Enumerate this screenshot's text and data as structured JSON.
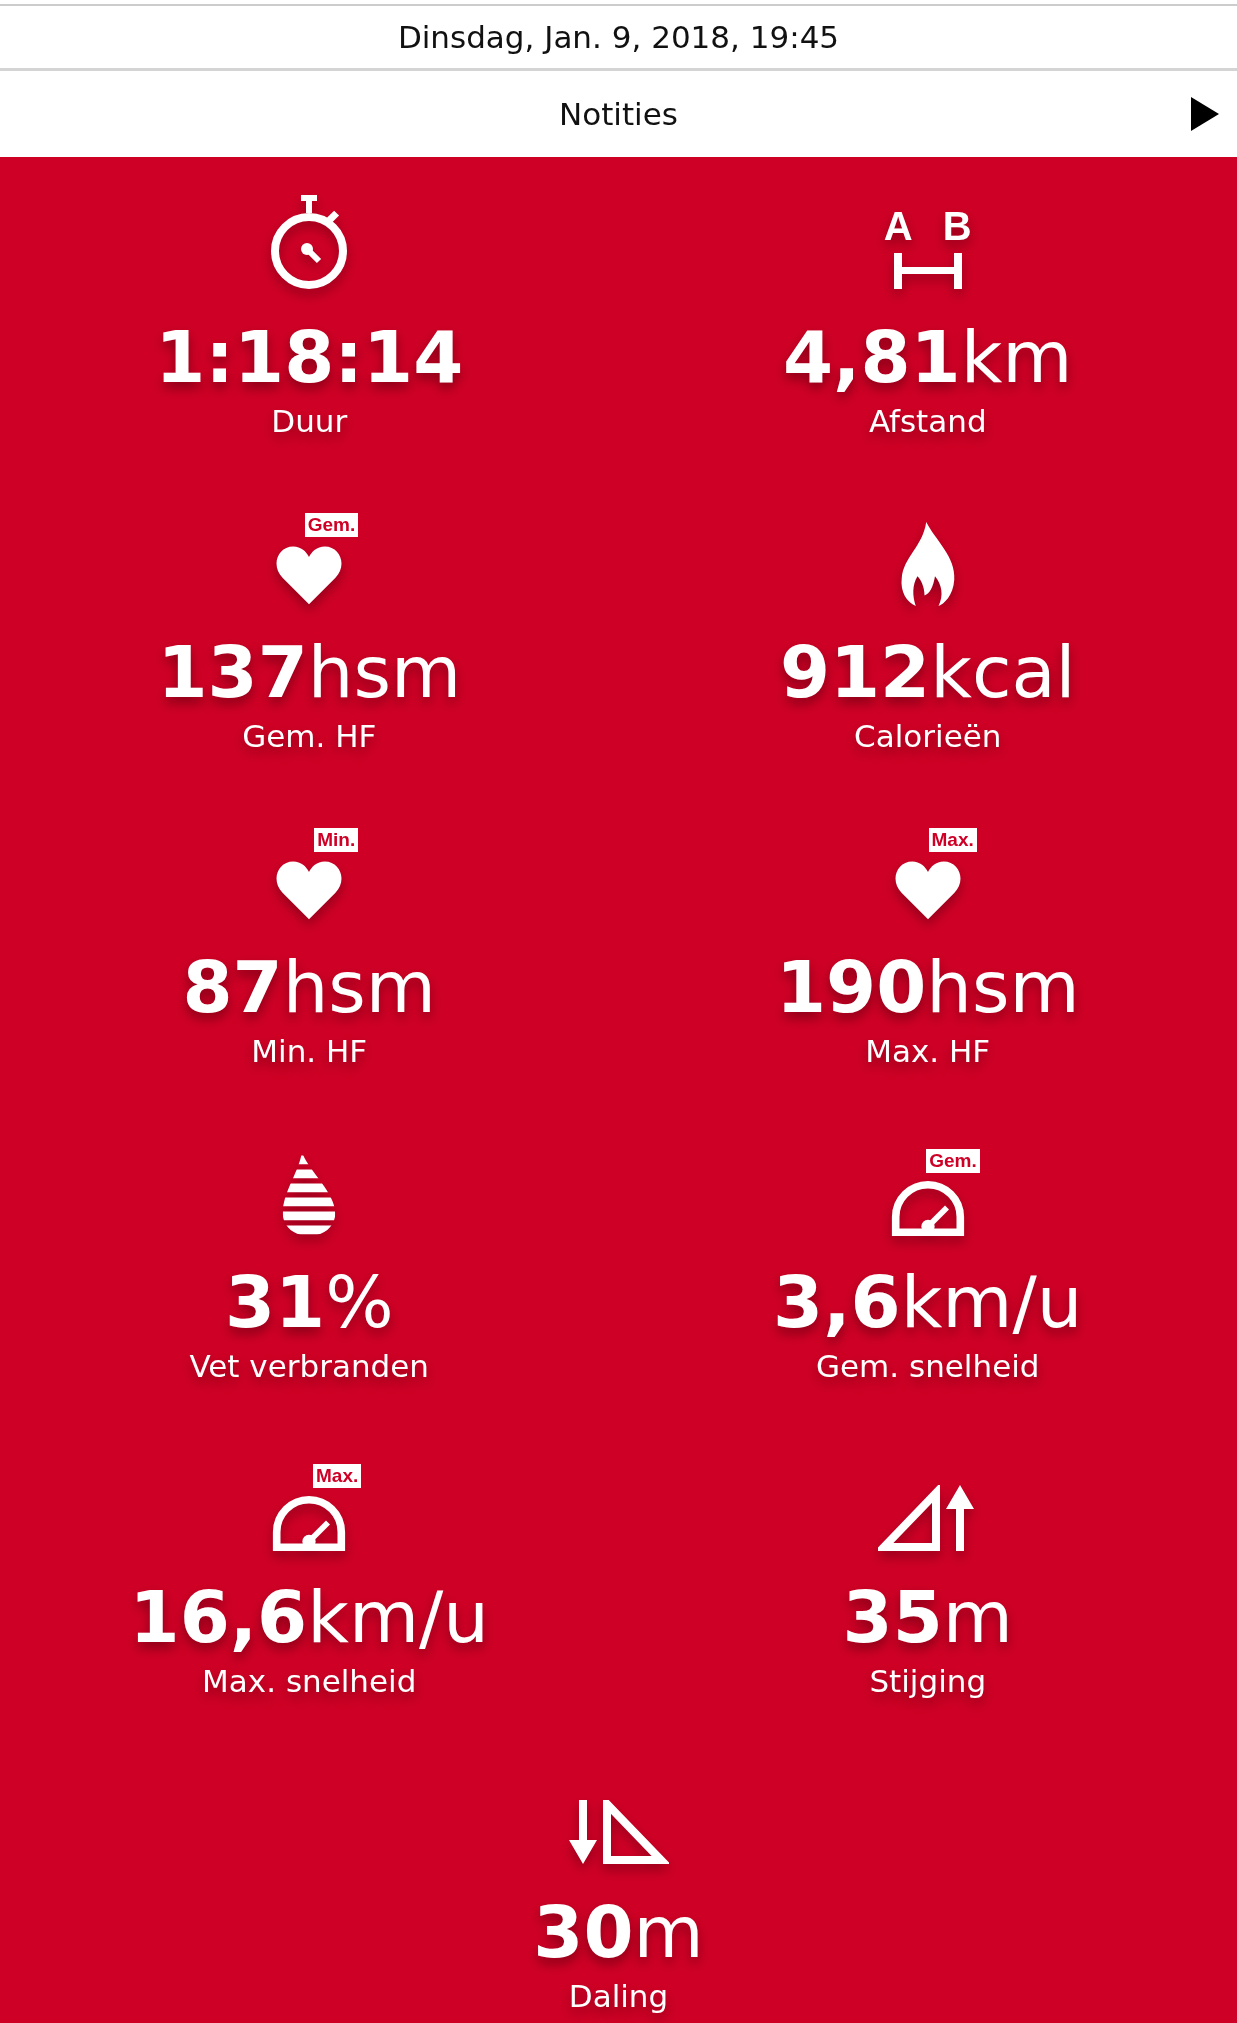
{
  "header": {
    "date": "Dinsdag, Jan. 9, 2018, 19:45"
  },
  "notes_row": {
    "label": "Notities"
  },
  "stats": [
    {
      "kind": "stopwatch",
      "value": "1:18:14",
      "label": "Duur"
    },
    {
      "kind": "distance",
      "markers": [
        "A",
        "B"
      ],
      "value": "4,81",
      "unit": "km",
      "label": "Afstand"
    },
    {
      "kind": "heart",
      "badge": "Gem.",
      "value": "137",
      "unit": "hsm",
      "label": "Gem. HF"
    },
    {
      "kind": "flame",
      "value": "912",
      "unit": "kcal",
      "label": "Calorieën"
    },
    {
      "kind": "heart",
      "badge": "Min.",
      "value": "87",
      "unit": "hsm",
      "label": "Min. HF"
    },
    {
      "kind": "heart",
      "badge": "Max.",
      "value": "190",
      "unit": "hsm",
      "label": "Max. HF"
    },
    {
      "kind": "fat",
      "value": "31",
      "unit": "%",
      "label": "Vet verbranden"
    },
    {
      "kind": "gauge",
      "badge": "Gem.",
      "value": "3,6",
      "unit": "km/u",
      "label": "Gem. snelheid"
    },
    {
      "kind": "gauge",
      "badge": "Max.",
      "value": "16,6",
      "unit": "km/u",
      "label": "Max. snelheid"
    },
    {
      "kind": "ascent",
      "value": "35",
      "unit": "m",
      "label": "Stijging"
    },
    {
      "kind": "descent",
      "value": "30",
      "unit": "m",
      "label": "Daling"
    }
  ]
}
